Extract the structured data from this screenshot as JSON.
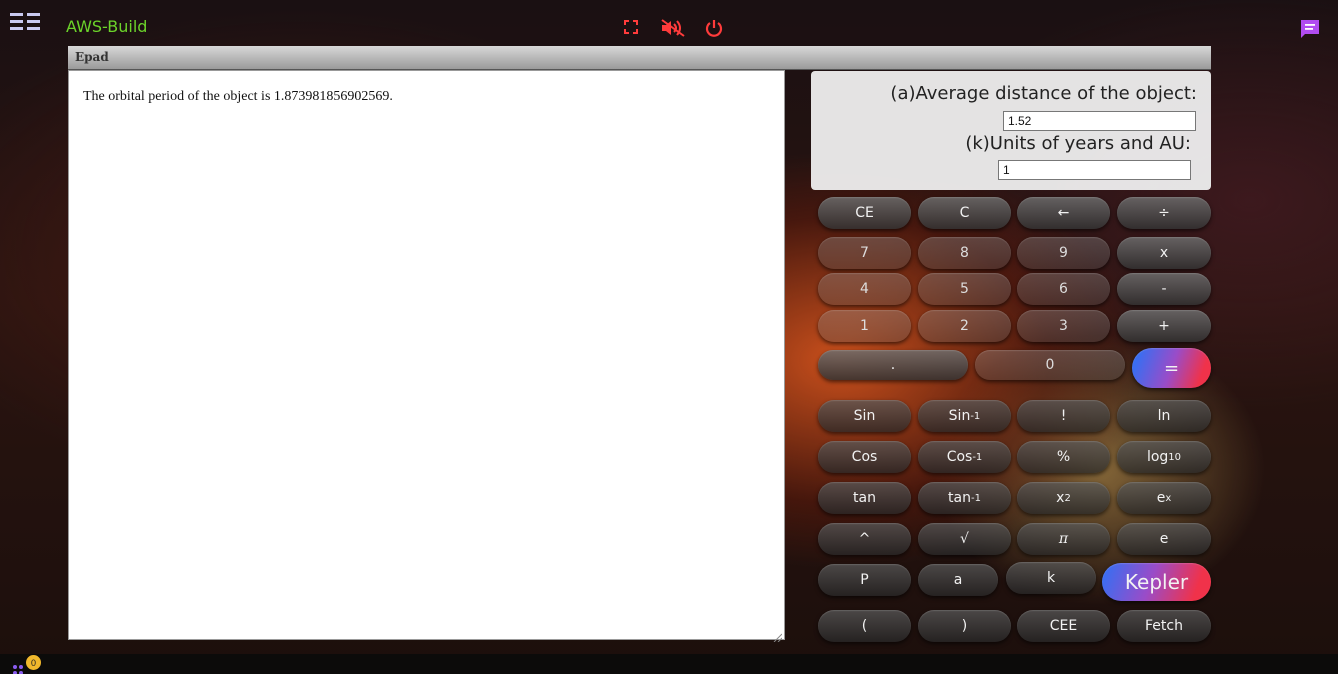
{
  "app": {
    "title": "AWS-Build"
  },
  "epad": {
    "header": "Epad",
    "output": "The orbital period of the object is 1.873981856902569."
  },
  "inputs": {
    "a_label": "(a)Average distance of the object:",
    "a_value": "1.52",
    "k_label": "(k)Units of years and AU:",
    "k_value": "1"
  },
  "keypad": {
    "ce": "CE",
    "c": "C",
    "backspace": "←",
    "divide": "÷",
    "n7": "7",
    "n8": "8",
    "n9": "9",
    "multiply": "x",
    "n4": "4",
    "n5": "5",
    "n6": "6",
    "minus": "-",
    "n1": "1",
    "n2": "2",
    "n3": "3",
    "plus": "+",
    "dot": ".",
    "n0": "0",
    "equals": "="
  },
  "functions": {
    "sin": "Sin",
    "asin_base": "Sin",
    "asin_exp": "-1",
    "fact": "!",
    "ln": "ln",
    "cos": "Cos",
    "acos_base": "Cos",
    "acos_exp": "-1",
    "percent": "%",
    "log_base": "log",
    "log_sub": "10",
    "tan": "tan",
    "atan_base": "tan",
    "atan_exp": "-1",
    "sq_base": "x",
    "sq_exp": "2",
    "exp_base": "e",
    "exp_exp": "x",
    "pow": "^",
    "sqrt": "√",
    "pi": "π",
    "e": "e",
    "p": "P",
    "a": "a",
    "k": "k",
    "kepler": "Kepler",
    "lparen": "(",
    "rparen": ")",
    "cee": "CEE",
    "fetch": "Fetch"
  },
  "footer": {
    "badge_count": "0"
  },
  "colors": {
    "title": "#6bd32a",
    "icons": "#ff3b3b",
    "chat": "#b14cf0",
    "badge": "#f1b82c"
  },
  "icons": [
    "menu-icon",
    "fullscreen-icon",
    "mute-icon",
    "power-icon",
    "chat-icon",
    "apps-icon"
  ]
}
